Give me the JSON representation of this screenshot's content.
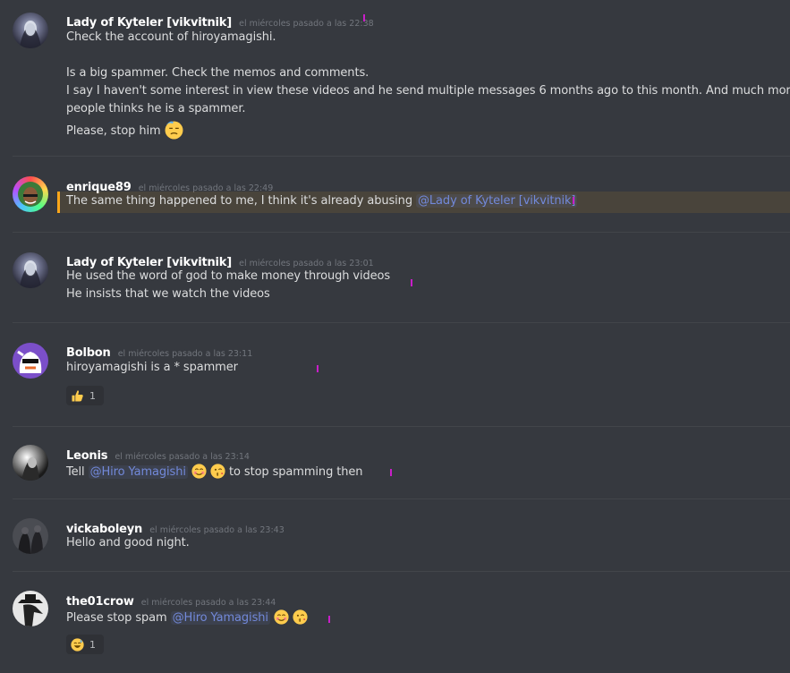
{
  "colors": {
    "background": "#36393f",
    "username": "#ffffff",
    "timestamp": "#72767d",
    "text": "#dcddde",
    "mention": "#7289da",
    "highlight_border": "#faa61a",
    "marker": "#c91ec9"
  },
  "messages": [
    {
      "username": "Lady of Kyteler [vikvitnik]",
      "timestamp": "el miércoles pasado a las 22:38",
      "lines": [
        "Check the account of hiroyamagishi.",
        "Is a big spammer. Check the memos and comments.",
        "I say I haven't some interest in view these videos and he send  multiple messages 6 months ago to this month. And much more",
        "people thinks he is a spammer.",
        "Please, stop him"
      ],
      "emoji": "unamused-face-emoji"
    },
    {
      "username": "enrique89",
      "timestamp": "el miércoles pasado a las 22:49",
      "text": "The same thing happened to me, I think it's already abusing ",
      "mention": "@Lady of Kyteler [vikvitnik]"
    },
    {
      "username": "Lady of Kyteler [vikvitnik]",
      "timestamp": "el miércoles pasado a las 23:01",
      "lines": [
        "He used the word of god to make money through videos",
        "He insists that we watch the videos"
      ]
    },
    {
      "username": "Bolbon",
      "timestamp": "el miércoles pasado a las 23:11",
      "text": "hiroyamagishi is a * spammer",
      "reaction": {
        "emoji": "thumbs-up-emoji",
        "count": "1"
      }
    },
    {
      "username": "Leonis",
      "timestamp": "el miércoles pasado a las 23:14",
      "text_before": "Tell ",
      "mention": "@Hiro Yamagishi",
      "text_after": " to stop spamming then",
      "emojis": [
        "smiling-face-emoji",
        "kissing-face-emoji"
      ]
    },
    {
      "username": "vickaboleyn",
      "timestamp": "el miércoles pasado a las 23:43",
      "text": "Hello and good night."
    },
    {
      "username": "the01crow",
      "timestamp": "el miércoles pasado a las 23:44",
      "text_before": "Please stop spam ",
      "mention": "@Hiro Yamagishi",
      "emojis": [
        "smiling-face-emoji",
        "kissing-face-emoji"
      ],
      "reaction": {
        "emoji": "sweat-smile-emoji",
        "count": "1"
      }
    }
  ]
}
